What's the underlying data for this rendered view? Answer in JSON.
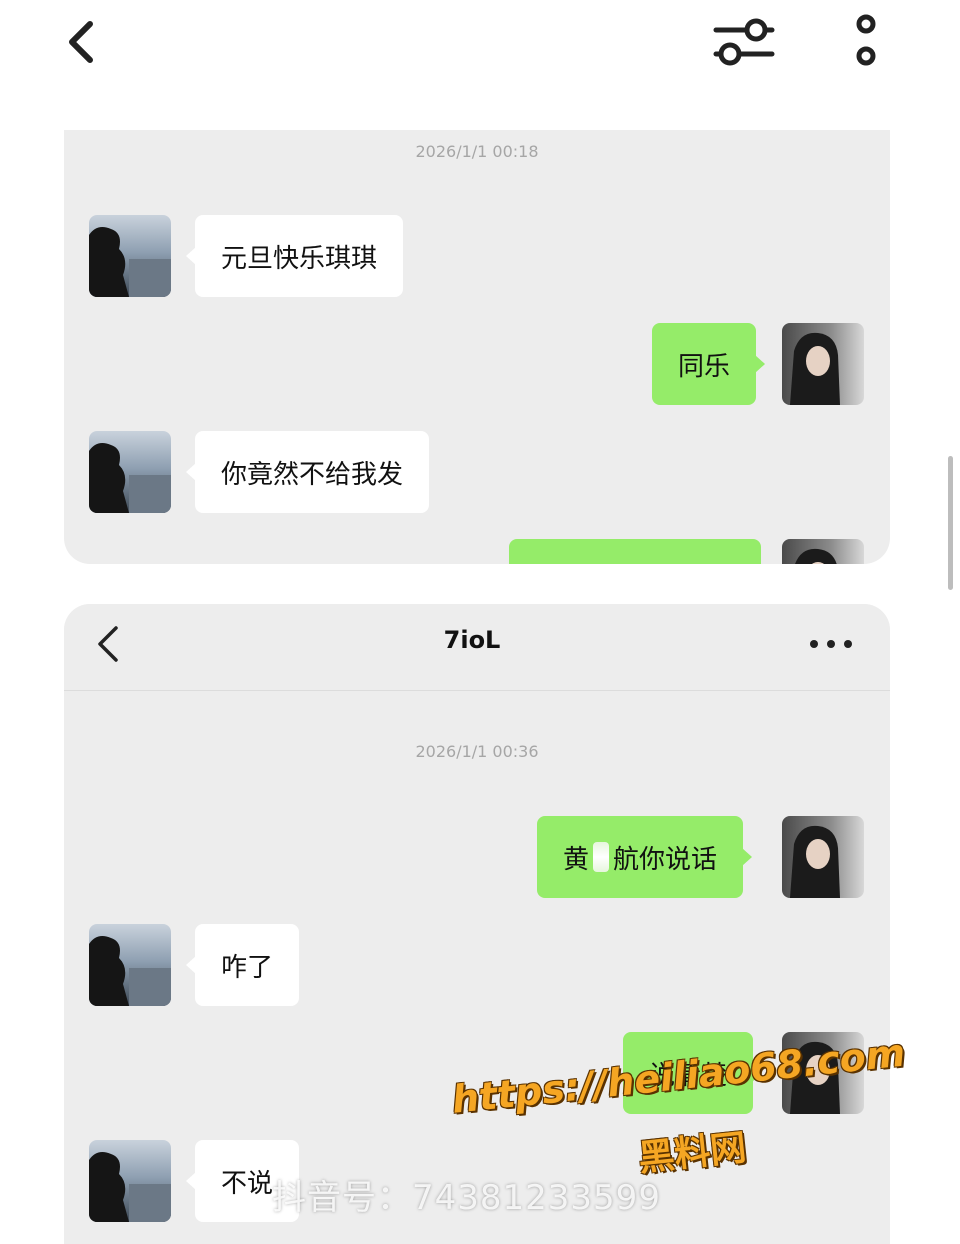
{
  "top_bar": {
    "back_icon": "chevron-left-icon",
    "filter_icon": "sliders-icon",
    "more_icon": "more-vertical-icon"
  },
  "chat1": {
    "timestamp": "2026/1/1 00:18",
    "messages": [
      {
        "side": "in",
        "text": "元旦快乐琪琪"
      },
      {
        "side": "out",
        "text": "同乐"
      },
      {
        "side": "in",
        "text": "你竟然不给我发"
      },
      {
        "side": "out",
        "text": ""
      }
    ]
  },
  "chat2": {
    "header": {
      "title": "7ioL",
      "back_icon": "chevron-left-icon",
      "more_icon": "more-horizontal-icon"
    },
    "timestamp": "2026/1/1 00:36",
    "messages": [
      {
        "side": "out",
        "text_before": "黄",
        "text_after": "航你说话"
      },
      {
        "side": "in",
        "text": "咋了"
      },
      {
        "side": "out",
        "text": "说清楚"
      },
      {
        "side": "in",
        "text": "不说"
      }
    ]
  },
  "watermarks": {
    "douyin": "抖音号：74381233599",
    "url": "https://heiliao68.com",
    "site_name": "黑料网"
  },
  "colors": {
    "chat_bg": "#ededed",
    "bubble_out": "#95ec69",
    "bubble_in": "#ffffff",
    "timestamp": "#a6a6a6"
  }
}
